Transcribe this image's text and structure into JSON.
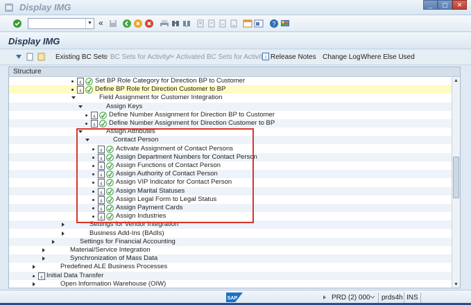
{
  "window": {
    "title": "Display IMG",
    "buttons": [
      "_",
      "▢",
      "✕"
    ]
  },
  "toolbar": {
    "command_value": "",
    "icons": [
      "enter-icon",
      "back-icon",
      "exit-icon",
      "cancel-icon",
      "print-icon",
      "find-icon",
      "find-next-icon",
      "first-page-icon",
      "prev-page-icon",
      "next-page-icon",
      "last-page-icon",
      "new-session-icon",
      "shortcut-icon",
      "help-icon",
      "layout-icon"
    ],
    "history_symbol": "«"
  },
  "page_title": "Display IMG",
  "app_toolbar": {
    "items": [
      {
        "label": "Existing BC Sets",
        "enabled": true
      },
      {
        "label": "BC Sets for Activity",
        "enabled": false
      },
      {
        "label": "Activated BC Sets for Activity",
        "enabled": false
      },
      {
        "label": "Release Notes",
        "enabled": true
      },
      {
        "label": "Change Log",
        "enabled": true
      },
      {
        "label": "Where Else Used",
        "enabled": true
      }
    ]
  },
  "tree": {
    "header": "Structure",
    "rows": [
      {
        "label": "Set BP Role Category for Direction BP to Customer",
        "kind": "activity"
      },
      {
        "label": "Define BP Role for Direction Customer to BP",
        "kind": "activity",
        "selected": true
      },
      {
        "label": "Field Assignment for Customer Integration",
        "kind": "expanded"
      },
      {
        "label": "Assign Keys",
        "kind": "expanded"
      },
      {
        "label": "Define Number Assignment for Direction BP to Customer",
        "kind": "activity"
      },
      {
        "label": "Define Number Assignment for Direction Customer to BP",
        "kind": "activity"
      },
      {
        "label": "Assign Attributes",
        "kind": "expanded"
      },
      {
        "label": "Contact Person",
        "kind": "expanded"
      },
      {
        "label": "Activate Assignment of Contact Persons",
        "kind": "activity"
      },
      {
        "label": "Assign Department Numbers for Contact Person",
        "kind": "activity"
      },
      {
        "label": "Assign Functions of Contact Person",
        "kind": "activity"
      },
      {
        "label": "Assign Authority of Contact Person",
        "kind": "activity"
      },
      {
        "label": "Assign VIP Indicator for Contact Person",
        "kind": "activity"
      },
      {
        "label": "Assign Marital Statuses",
        "kind": "activity"
      },
      {
        "label": "Assign Legal Form to Legal Status",
        "kind": "activity"
      },
      {
        "label": "Assign Payment Cards",
        "kind": "activity"
      },
      {
        "label": "Assign Industries",
        "kind": "activity"
      },
      {
        "label": "Settings for Vendor Integration",
        "kind": "collapsed"
      },
      {
        "label": "Business Add-Ins (BAdIs)",
        "kind": "collapsed"
      },
      {
        "label": "Settings for Financial Accounting",
        "kind": "collapsed"
      },
      {
        "label": "Material/Service Integration",
        "kind": "collapsed"
      },
      {
        "label": "Synchronization of Mass Data",
        "kind": "collapsed"
      },
      {
        "label": "Predefined ALE Business Processes",
        "kind": "collapsed"
      },
      {
        "label": "Initial Data Transfer",
        "kind": "doc"
      },
      {
        "label": "Open Information Warehouse (OIW)",
        "kind": "collapsed"
      }
    ]
  },
  "statusbar": {
    "system": "PRD (2) 000",
    "server": "prds4h",
    "mode": "INS",
    "logo_text": "SAP"
  },
  "colors": {
    "selected_row": "#fffbc3",
    "highlight_box": "#d9342b"
  }
}
